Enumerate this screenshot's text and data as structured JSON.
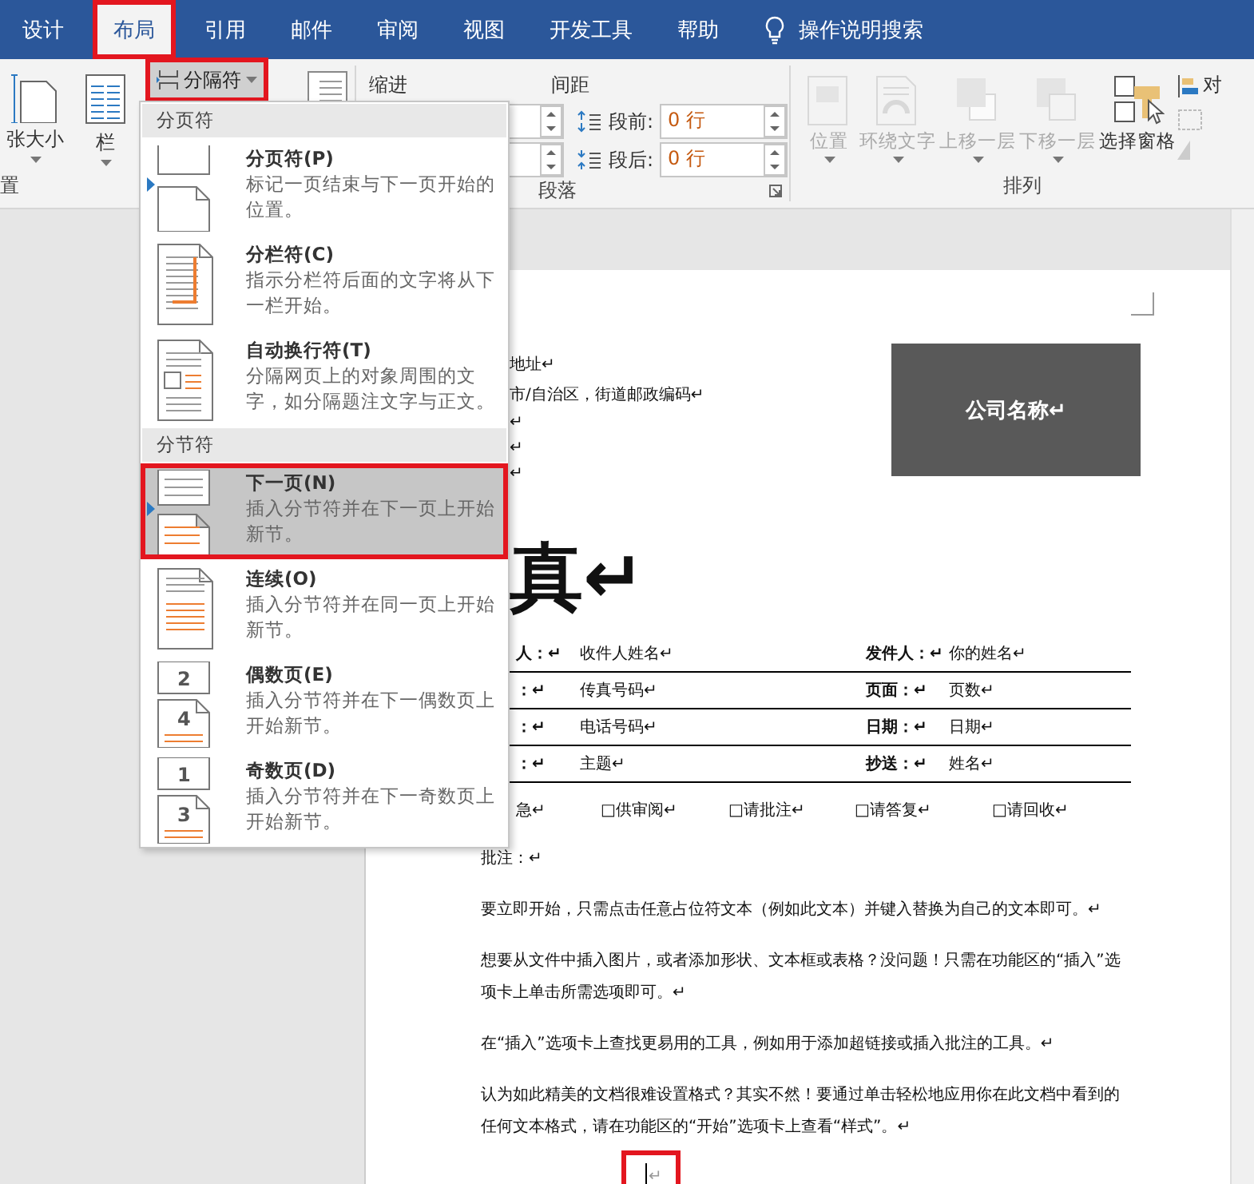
{
  "tabs": [
    {
      "label": "设计",
      "selected": false
    },
    {
      "label": "布局",
      "selected": true
    },
    {
      "label": "引用",
      "selected": false
    },
    {
      "label": "邮件",
      "selected": false
    },
    {
      "label": "审阅",
      "selected": false
    },
    {
      "label": "视图",
      "selected": false
    },
    {
      "label": "开发工具",
      "selected": false
    },
    {
      "label": "帮助",
      "selected": false
    }
  ],
  "tell_me": {
    "label": "操作说明搜索"
  },
  "ribbon": {
    "page_setup": {
      "buttons": [
        {
          "kind": "size",
          "label": "张大小"
        },
        {
          "kind": "columns",
          "label": "栏"
        }
      ],
      "breaks_button": {
        "label": "分隔符",
        "highlighted": true
      },
      "group_label": "置"
    },
    "paragraph": {
      "indent_label": "缩进",
      "spacing_label": "间距",
      "spacing": [
        {
          "kind": "before",
          "label": "段前:",
          "value": "0 行"
        },
        {
          "kind": "after",
          "label": "段后:",
          "value": "0 行"
        }
      ],
      "group_label": "段落"
    },
    "arrange": {
      "buttons": [
        {
          "kind": "position",
          "label": "位置",
          "disabled": true
        },
        {
          "kind": "wrap",
          "label": "环绕文字",
          "disabled": true
        },
        {
          "kind": "forward",
          "label": "上移一层",
          "disabled": true
        },
        {
          "kind": "backward",
          "label": "下移一层",
          "disabled": true
        },
        {
          "kind": "pane",
          "label": "选择窗格",
          "disabled": false
        }
      ],
      "side_label": "对",
      "group_label": "排列"
    }
  },
  "breaks_menu": {
    "sections": [
      {
        "header": "分页符",
        "items": [
          {
            "kind": "page",
            "title": "分页符(P)",
            "description": "标记一页结束与下一页开始的位置。",
            "selected": false,
            "marked": true
          },
          {
            "kind": "column",
            "title": "分栏符(C)",
            "description": "指示分栏符后面的文字将从下一栏开始。",
            "selected": false,
            "marked": false
          },
          {
            "kind": "wrap",
            "title": "自动换行符(T)",
            "description": "分隔网页上的对象周围的文字，如分隔题注文字与正文。",
            "selected": false,
            "marked": false
          }
        ]
      },
      {
        "header": "分节符",
        "items": [
          {
            "kind": "next",
            "title": "下一页(N)",
            "description": "插入分节符并在下一页上开始新节。",
            "selected": true,
            "marked": true
          },
          {
            "kind": "continuous",
            "title": "连续(O)",
            "description": "插入分节符并在同一页上开始新节。",
            "selected": false,
            "marked": false
          },
          {
            "kind": "even",
            "title": "偶数页(E)",
            "description": "插入分节符并在下一偶数页上开始新节。",
            "selected": false,
            "marked": false,
            "page_numbers": [
              "2",
              "4"
            ]
          },
          {
            "kind": "odd",
            "title": "奇数页(D)",
            "description": "插入分节符并在下一奇数页上开始新节。",
            "selected": false,
            "marked": false,
            "page_numbers": [
              "1",
              "3"
            ]
          }
        ]
      }
    ]
  },
  "document": {
    "address_lines": [
      "地址↵",
      "市/自治区，街道邮政编码↵",
      "↵",
      "↵",
      "↵"
    ],
    "company": "公司名称↵",
    "title": "真↵",
    "fields": [
      {
        "label": "人：↵",
        "value": "收件人姓名↵",
        "label_2": "发件人：↵",
        "value_2": "你的姓名↵"
      },
      {
        "label": "：↵",
        "value": "传真号码↵",
        "label_2": "页面：↵",
        "value_2": "页数↵"
      },
      {
        "label": "：↵",
        "value": "电话号码↵",
        "label_2": "日期：↵",
        "value_2": "日期↵"
      },
      {
        "label": "：↵",
        "value": "主题↵",
        "label_2": "抄送：↵",
        "value_2": "姓名↵"
      }
    ],
    "options": [
      "急↵",
      "□供审阅↵",
      "□请批注↵",
      "□请答复↵",
      "□请回收↵"
    ],
    "paragraphs": [
      "批注：↵",
      "要立即开始，只需点击任意占位符文本（例如此文本）并键入替换为自己的文本即可。↵",
      "想要从文件中插入图片，或者添加形状、文本框或表格？没问题！只需在功能区的“插入”选项卡上单击所需选项即可。↵",
      "在“插入”选项卡上查找更易用的工具，例如用于添加超链接或插入批注的工具。↵",
      "认为如此精美的文档很难设置格式？其实不然！要通过单击轻松地应用你在此文档中看到的任何文本格式，请在功能区的“开始”选项卡上查看“样式”。↵"
    ],
    "cursor_line": {
      "mark": "↵",
      "highlighted": true
    }
  }
}
